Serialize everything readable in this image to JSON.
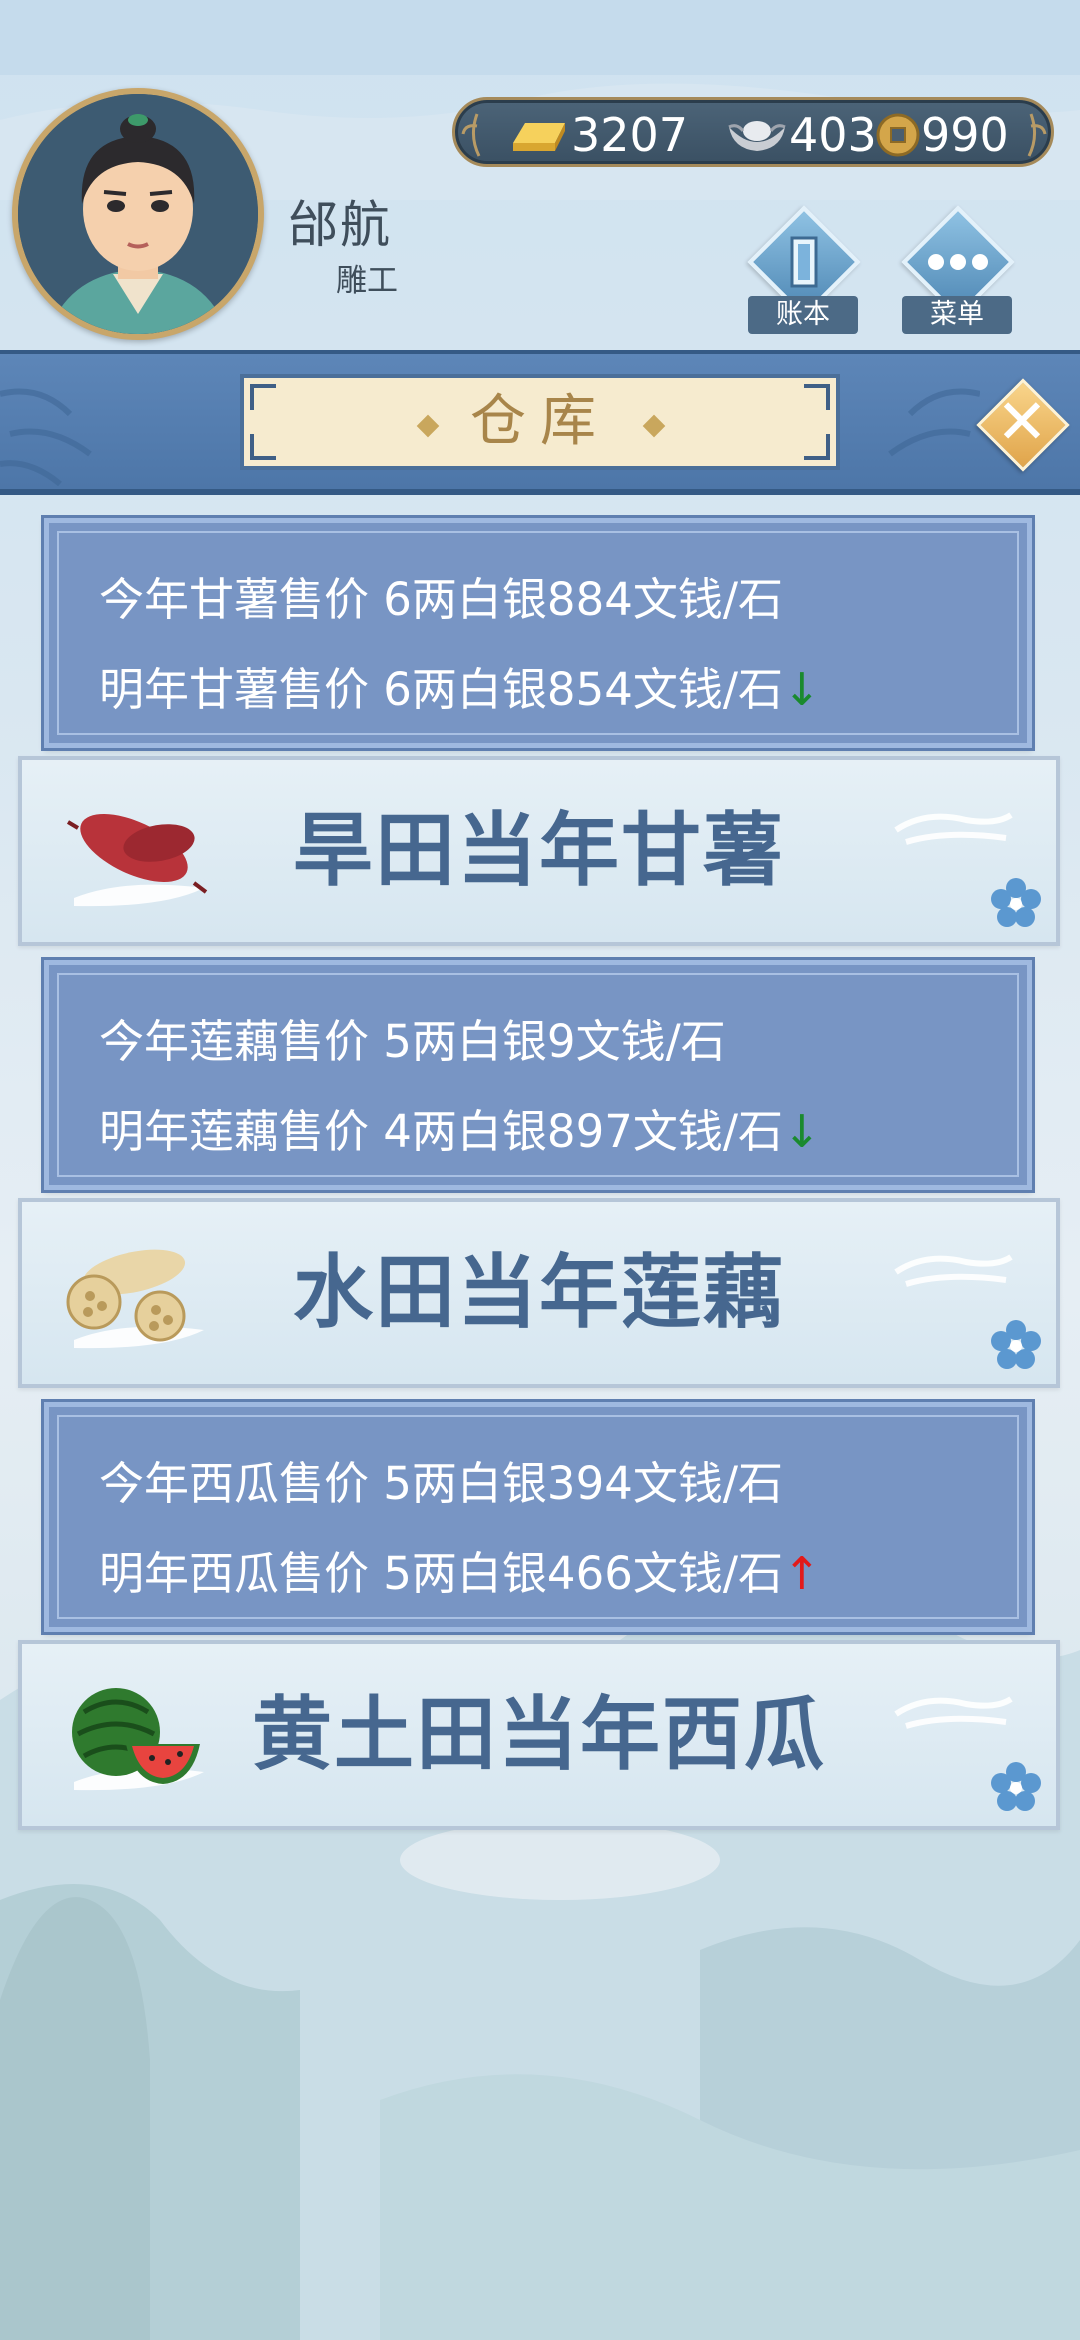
{
  "player": {
    "name": "邰航",
    "title": "雕工"
  },
  "currency": {
    "gold": "3207",
    "silver": "403",
    "coins": "990"
  },
  "header_buttons": {
    "ledger_label": "账本",
    "menu_label": "菜单"
  },
  "panel": {
    "title": "仓库"
  },
  "crops": [
    {
      "this_year": "今年甘薯售价 6两白银884文钱/石",
      "next_year": "明年甘薯售价 6两白银854文钱/石",
      "trend": "↓",
      "trend_dir": "down",
      "card_label": "旱田当年甘薯",
      "icon": "sweet-potato-icon"
    },
    {
      "this_year": "今年莲藕售价 5两白银9文钱/石",
      "next_year": "明年莲藕售价 4两白银897文钱/石",
      "trend": "↓",
      "trend_dir": "down",
      "card_label": "水田当年莲藕",
      "icon": "lotus-root-icon"
    },
    {
      "this_year": "今年西瓜售价 5两白银394文钱/石",
      "next_year": "明年西瓜售价 5两白银466文钱/石",
      "trend": "↑",
      "trend_dir": "up",
      "card_label": "黄土田当年西瓜",
      "icon": "watermelon-icon"
    }
  ],
  "colors": {
    "panel_blue": "#7895c4",
    "banner_blue": "#5d86b8",
    "card_text": "#46678f",
    "trend_down": "#1a8a2e",
    "trend_up": "#e21a1a",
    "title_gold": "#a8854a"
  }
}
